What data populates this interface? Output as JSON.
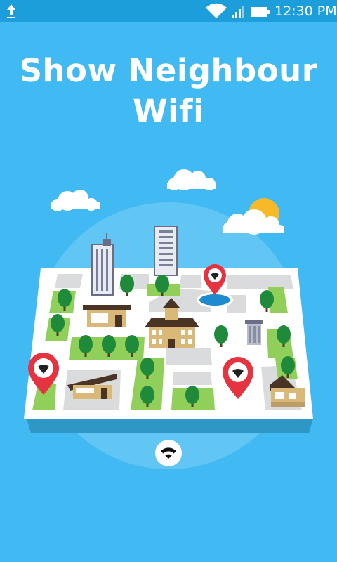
{
  "status_bar": {
    "time": "12:30 PM",
    "icons": [
      "upload-icon",
      "wifi-icon",
      "cell-signal-icon",
      "battery-icon"
    ]
  },
  "app": {
    "title_line1": "Show Neighbour",
    "title_line2": "Wifi"
  },
  "colors": {
    "background": "#41b9f2",
    "status_bar": "#1c9edb",
    "pin_red": "#e5343f",
    "tree_green": "#1f8a3a",
    "grass": "#8fcf5a",
    "sun": "#f7b928"
  },
  "illustration": {
    "icons": [
      "cloud-icon",
      "sun-icon",
      "building-icon",
      "tree-icon",
      "house-icon",
      "fountain-icon",
      "wifi-pin-icon"
    ]
  }
}
